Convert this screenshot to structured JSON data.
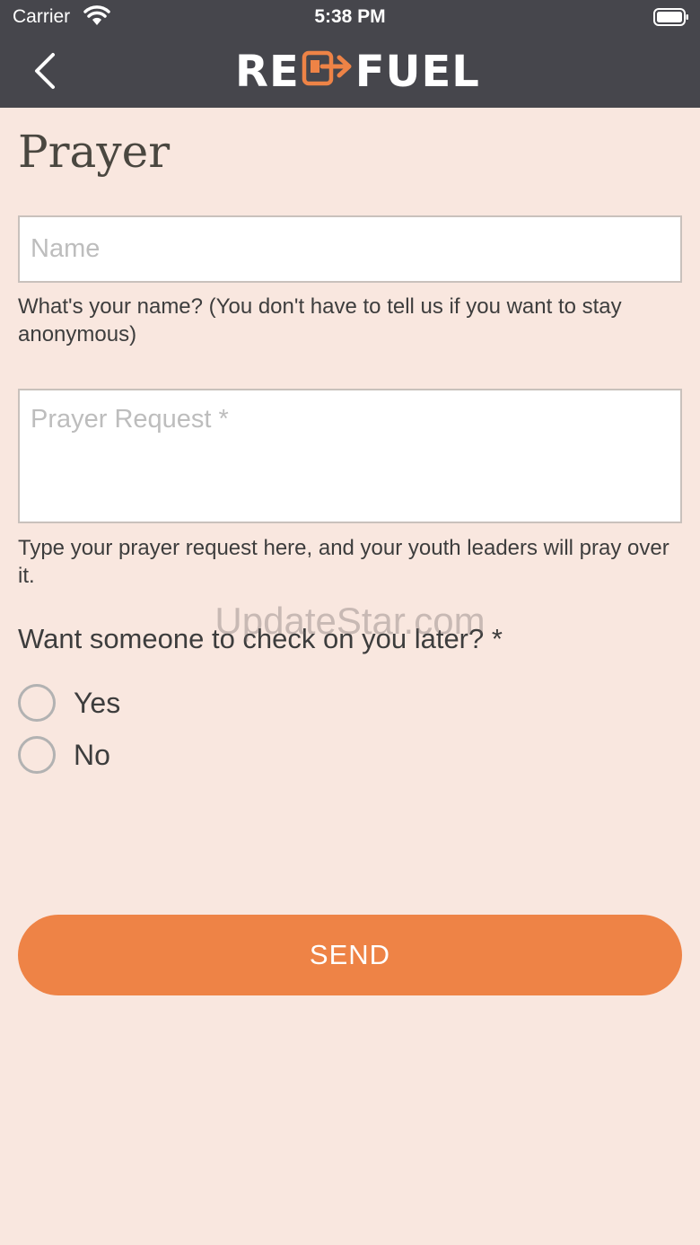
{
  "status_bar": {
    "carrier": "Carrier",
    "time": "5:38 PM"
  },
  "nav": {
    "logo_left": "RE",
    "logo_right": "FUEL",
    "accent_color": "#ee8346"
  },
  "page": {
    "title": "Prayer"
  },
  "form": {
    "name_placeholder": "Name",
    "name_value": "",
    "name_hint": "What's your name?  (You don't have to tell us if you want to stay anonymous)",
    "request_placeholder": "Prayer Request *",
    "request_value": "",
    "request_hint": "Type your prayer request here, and your youth leaders will pray over it.",
    "question": "Want someone to check on you later? *",
    "options": [
      {
        "label": "Yes",
        "selected": false
      },
      {
        "label": "No",
        "selected": false
      }
    ],
    "send_label": "SEND"
  },
  "watermark": "UpdateStar.com"
}
